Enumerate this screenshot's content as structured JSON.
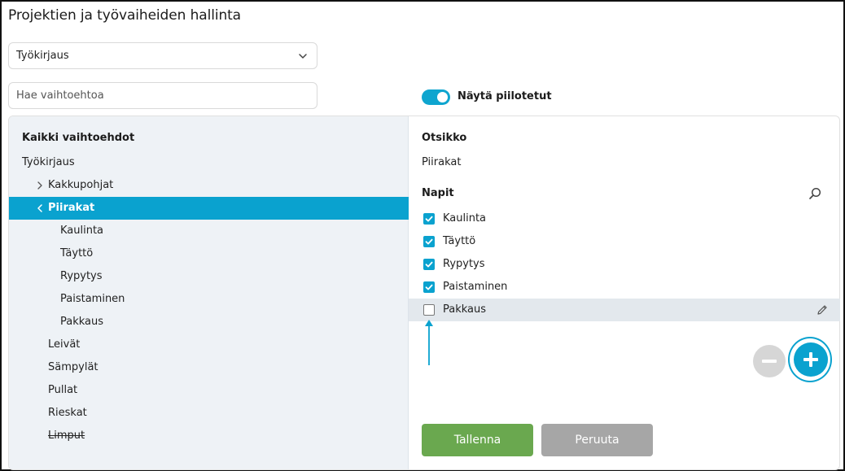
{
  "app": {
    "title": "Projektien ja työvaiheiden hallinta"
  },
  "select": {
    "value": "Työkirjaus"
  },
  "search": {
    "placeholder": "Hae vaihtoehtoa"
  },
  "toggle": {
    "label": "Näytä piilotetut",
    "on": true
  },
  "tree": {
    "heading": "Kaikki vaihtoehdot",
    "root": "Työkirjaus",
    "items": [
      {
        "label": "Kakkupohjat",
        "level": 1,
        "expandable": true,
        "expanded": false
      },
      {
        "label": "Piirakat",
        "level": 1,
        "expandable": true,
        "expanded": true,
        "selected": true
      },
      {
        "label": "Kaulinta",
        "level": 2
      },
      {
        "label": "Täyttö",
        "level": 2
      },
      {
        "label": "Rypytys",
        "level": 2
      },
      {
        "label": "Paistaminen",
        "level": 2
      },
      {
        "label": "Pakkaus",
        "level": 2
      },
      {
        "label": "Leivät",
        "level": 1
      },
      {
        "label": "Sämpylät",
        "level": 1
      },
      {
        "label": "Pullat",
        "level": 1
      },
      {
        "label": "Rieskat",
        "level": 1
      },
      {
        "label": "Limput",
        "level": 1,
        "hidden": true
      }
    ]
  },
  "detail": {
    "title_heading": "Otsikko",
    "title_value": "Piirakat",
    "buttons_heading": "Napit",
    "buttons": [
      {
        "label": "Kaulinta",
        "checked": true
      },
      {
        "label": "Täyttö",
        "checked": true
      },
      {
        "label": "Rypytys",
        "checked": true
      },
      {
        "label": "Paistaminen",
        "checked": true
      },
      {
        "label": "Pakkaus",
        "checked": false,
        "highlighted": true
      }
    ]
  },
  "actions": {
    "save_label": "Tallenna",
    "cancel_label": "Peruuta"
  },
  "colors": {
    "accent": "#0aa2cf",
    "save": "#6aa84f",
    "cancel": "#a6a6a6",
    "sidebar_bg": "#eef2f6"
  }
}
